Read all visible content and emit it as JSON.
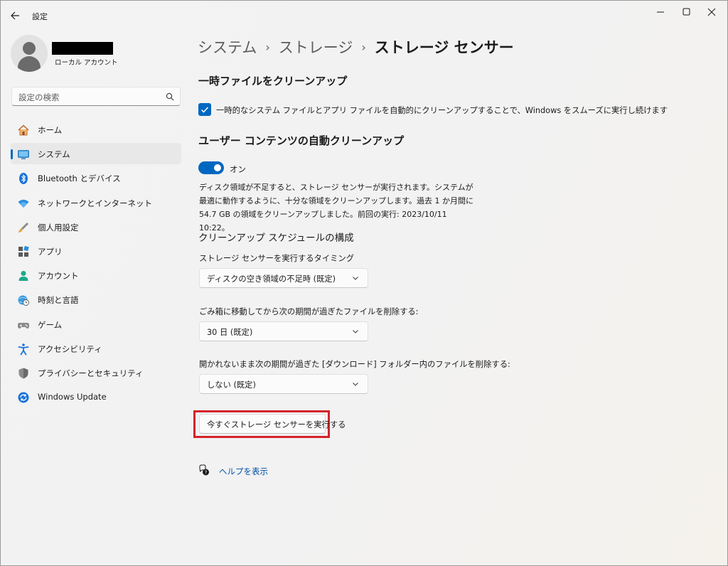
{
  "window": {
    "title": "設定",
    "icons": {
      "back": "back-arrow-icon",
      "minimize": "minimize-icon",
      "maximize": "maximize-icon",
      "close": "close-icon"
    }
  },
  "profile": {
    "account_type": "ローカル アカウント",
    "name_redacted": true
  },
  "search": {
    "placeholder": "設定の検索",
    "icon": "search-icon"
  },
  "sidebar": {
    "accent_color": "#0067c0",
    "items": [
      {
        "label": "ホーム",
        "icon": "home-icon",
        "active": false
      },
      {
        "label": "システム",
        "icon": "monitor-icon",
        "active": true
      },
      {
        "label": "Bluetooth とデバイス",
        "icon": "bluetooth-icon",
        "active": false
      },
      {
        "label": "ネットワークとインターネット",
        "icon": "wifi-icon",
        "active": false
      },
      {
        "label": "個人用設定",
        "icon": "brush-icon",
        "active": false
      },
      {
        "label": "アプリ",
        "icon": "apps-icon",
        "active": false
      },
      {
        "label": "アカウント",
        "icon": "person-icon",
        "active": false
      },
      {
        "label": "時刻と言語",
        "icon": "globe-clock-icon",
        "active": false
      },
      {
        "label": "ゲーム",
        "icon": "gamepad-icon",
        "active": false
      },
      {
        "label": "アクセシビリティ",
        "icon": "accessibility-icon",
        "active": false
      },
      {
        "label": "プライバシーとセキュリティ",
        "icon": "shield-icon",
        "active": false
      },
      {
        "label": "Windows Update",
        "icon": "update-icon",
        "active": false
      }
    ]
  },
  "breadcrumb": {
    "items": [
      "システム",
      "ストレージ"
    ],
    "separator": "›",
    "current": "ストレージ センサー"
  },
  "temp_files": {
    "heading": "一時ファイルをクリーンアップ",
    "checkbox_label": "一時的なシステム ファイルとアプリ ファイルを自動的にクリーンアップすることで、Windows をスムーズに実行し続けます",
    "checked": true
  },
  "user_content": {
    "heading": "ユーザー コンテンツの自動クリーンアップ",
    "toggle_label": "オン",
    "toggle_on": true,
    "description": "ディスク領域が不足すると、ストレージ センサーが実行されます。システムが最適に動作するように、十分な領域をクリーンアップします。過去 1 か月間に 54.7 GB の領域をクリーンアップしました。前回の実行: 2023/10/11 10:22。"
  },
  "schedule": {
    "heading": "クリーンアップ スケジュールの構成",
    "run_timing": {
      "label": "ストレージ センサーを実行するタイミング",
      "value": "ディスクの空き領域の不足時 (既定)"
    },
    "recycle_bin": {
      "label": "ごみ箱に移動してから次の期間が過ぎたファイルを削除する:",
      "value": "30 日 (既定)"
    },
    "downloads": {
      "label": "開かれないまま次の期間が過ぎた [ダウンロード] フォルダー内のファイルを削除する:",
      "value": "しない (既定)"
    }
  },
  "run_now": {
    "label": "今すぐストレージ センサーを実行する",
    "highlight_color": "#d4242a"
  },
  "help": {
    "label": "ヘルプを表示",
    "icon": "help-icon"
  }
}
